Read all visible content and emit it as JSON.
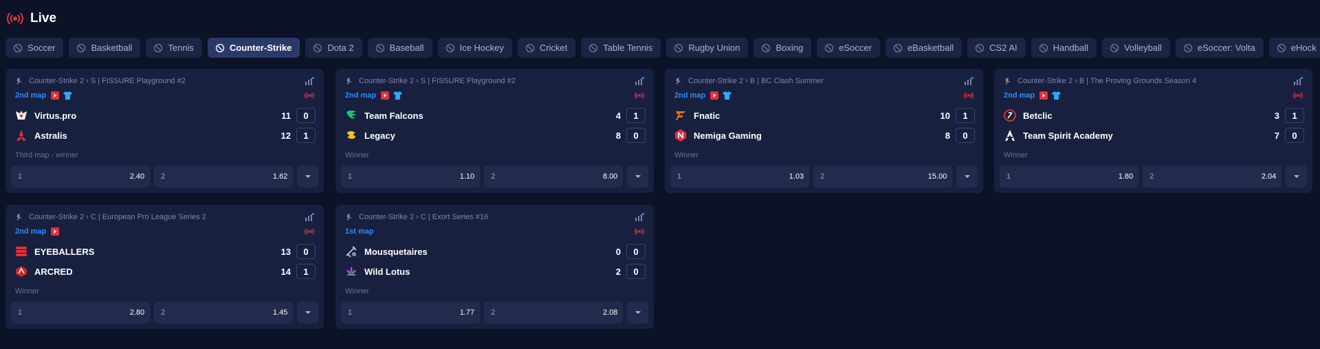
{
  "header": {
    "title": "Live",
    "live_icon": "live-broadcast-icon"
  },
  "tabs": [
    {
      "label": "Soccer",
      "icon": "soccer-ball-icon",
      "active": false
    },
    {
      "label": "Basketball",
      "icon": "basketball-icon",
      "active": false
    },
    {
      "label": "Tennis",
      "icon": "tennis-icon",
      "active": false
    },
    {
      "label": "Counter-Strike",
      "icon": "counter-strike-icon",
      "active": true
    },
    {
      "label": "Dota 2",
      "icon": "dota2-icon",
      "active": false
    },
    {
      "label": "Baseball",
      "icon": "baseball-bat-icon",
      "active": false
    },
    {
      "label": "Ice Hockey",
      "icon": "hockey-stick-icon",
      "active": false
    },
    {
      "label": "Cricket",
      "icon": "cricket-bat-icon",
      "active": false
    },
    {
      "label": "Table Tennis",
      "icon": "table-tennis-icon",
      "active": false
    },
    {
      "label": "Rugby Union",
      "icon": "rugby-ball-icon",
      "active": false
    },
    {
      "label": "Boxing",
      "icon": "boxing-glove-icon",
      "active": false
    },
    {
      "label": "eSoccer",
      "icon": "esoccer-icon",
      "active": false
    },
    {
      "label": "eBasketball",
      "icon": "ebasketball-icon",
      "active": false
    },
    {
      "label": "CS2 AI",
      "icon": "cs2-ai-icon",
      "active": false
    },
    {
      "label": "Handball",
      "icon": "handball-icon",
      "active": false
    },
    {
      "label": "Volleyball",
      "icon": "volleyball-icon",
      "active": false
    },
    {
      "label": "eSoccer: Volta",
      "icon": "esoccer-volta-icon",
      "active": false
    },
    {
      "label": "eHock",
      "icon": "ehockey-icon",
      "active": false
    }
  ],
  "colors": {
    "background": "#0c1228",
    "card": "#18203f",
    "accent": "#2f8cff",
    "live_red": "#e5303a"
  },
  "matches": [
    {
      "tournament": "Counter-Strike 2 › S | FISSURE Playground #2",
      "map": "2nd map",
      "has_video": true,
      "has_shirt": true,
      "teams": [
        {
          "name": "Virtus.pro",
          "score": "11",
          "maps": "0",
          "logo": "virtus-pro-logo-icon"
        },
        {
          "name": "Astralis",
          "score": "12",
          "maps": "1",
          "logo": "astralis-logo-icon"
        }
      ],
      "market": "Third map - winner",
      "odds": [
        {
          "label": "1",
          "value": "2.40"
        },
        {
          "label": "2",
          "value": "1.62"
        }
      ]
    },
    {
      "tournament": "Counter-Strike 2 › S | FISSURE Playground #2",
      "map": "2nd map",
      "has_video": true,
      "has_shirt": true,
      "teams": [
        {
          "name": "Team Falcons",
          "score": "4",
          "maps": "1",
          "logo": "falcons-logo-icon"
        },
        {
          "name": "Legacy",
          "score": "8",
          "maps": "0",
          "logo": "legacy-logo-icon"
        }
      ],
      "market": "Winner",
      "odds": [
        {
          "label": "1",
          "value": "1.10"
        },
        {
          "label": "2",
          "value": "8.00"
        }
      ]
    },
    {
      "tournament": "Counter-Strike 2 › B | BC Clash Summer",
      "map": "2nd map",
      "has_video": true,
      "has_shirt": true,
      "teams": [
        {
          "name": "Fnatic",
          "score": "10",
          "maps": "1",
          "logo": "fnatic-logo-icon"
        },
        {
          "name": "Nemiga Gaming",
          "score": "8",
          "maps": "0",
          "logo": "nemiga-logo-icon"
        }
      ],
      "market": "Winner",
      "odds": [
        {
          "label": "1",
          "value": "1.03"
        },
        {
          "label": "2",
          "value": "15.00"
        }
      ]
    },
    {
      "tournament": "Counter-Strike 2 › B | The Proving Grounds Season 4",
      "map": "2nd map",
      "has_video": true,
      "has_shirt": true,
      "teams": [
        {
          "name": "Betclic",
          "score": "3",
          "maps": "1",
          "logo": "betclic-logo-icon"
        },
        {
          "name": "Team Spirit Academy",
          "score": "7",
          "maps": "0",
          "logo": "spirit-logo-icon"
        }
      ],
      "market": "Winner",
      "odds": [
        {
          "label": "1",
          "value": "1.80"
        },
        {
          "label": "2",
          "value": "2.04"
        }
      ]
    },
    {
      "tournament": "Counter-Strike 2 › C | European Pro League Series 2",
      "map": "2nd map",
      "has_video": true,
      "has_shirt": false,
      "teams": [
        {
          "name": "EYEBALLERS",
          "score": "13",
          "maps": "0",
          "logo": "eyeballers-logo-icon"
        },
        {
          "name": "ARCRED",
          "score": "14",
          "maps": "1",
          "logo": "arcred-logo-icon"
        }
      ],
      "market": "Winner",
      "odds": [
        {
          "label": "1",
          "value": "2.80"
        },
        {
          "label": "2",
          "value": "1.45"
        }
      ]
    },
    {
      "tournament": "Counter-Strike 2 › C | Exort Series #16",
      "map": "1st map",
      "has_video": false,
      "has_shirt": false,
      "teams": [
        {
          "name": "Mousquetaires",
          "score": "0",
          "maps": "0",
          "logo": "mousquetaires-logo-icon"
        },
        {
          "name": "Wild Lotus",
          "score": "2",
          "maps": "0",
          "logo": "wild-lotus-logo-icon"
        }
      ],
      "market": "Winner",
      "odds": [
        {
          "label": "1",
          "value": "1.77"
        },
        {
          "label": "2",
          "value": "2.08"
        }
      ]
    }
  ]
}
